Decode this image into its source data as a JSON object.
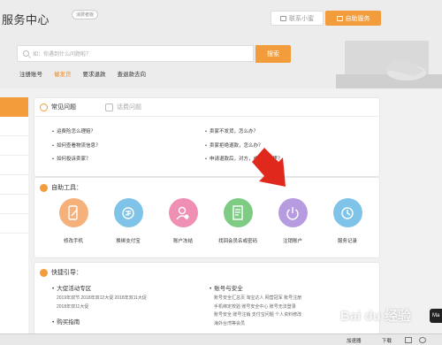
{
  "header": {
    "title": "服务中心",
    "beta_badge": "消费者版",
    "contact_label": "联系小蜜",
    "self_service_label": "自助服务"
  },
  "search": {
    "placeholder": "如：你遇到什么问题啦？",
    "button_label": "搜索"
  },
  "quick_links": [
    "注册账号",
    "催发货",
    "要求退款",
    "查退款去向"
  ],
  "faq": {
    "tab_active": "常见问题",
    "tab_inactive": "话费问题",
    "col1": [
      "运费险怎么理赔？",
      "如何查看物流信息？",
      "如何投诉卖家？"
    ],
    "col2": [
      "卖家不发货，怎么办？",
      "卖家拒绝退款，怎么办？",
      "申请退款后，对方，或退到哪里？"
    ]
  },
  "tools": {
    "title": "自助工具：",
    "items": [
      {
        "label": "修改手机",
        "color": "#f6b07a",
        "icon": "phone-edit-icon"
      },
      {
        "label": "换绑支付宝",
        "color": "#7fc3e8",
        "icon": "alipay-rebind-icon"
      },
      {
        "label": "账户冻结",
        "color": "#ef8fb3",
        "icon": "account-freeze-icon"
      },
      {
        "label": "找回会员名或密码",
        "color": "#7ecb84",
        "icon": "document-icon"
      },
      {
        "label": "注销账户",
        "color": "#b69be0",
        "icon": "power-icon"
      },
      {
        "label": "服务记录",
        "color": "#7fc3e8",
        "icon": "history-icon"
      }
    ]
  },
  "guide": {
    "title": "快捷引导：",
    "col1": {
      "head": "大促活动专区",
      "links": [
        "2019年双节  2018年双12大促  2018年双11大促",
        "2018年双11大促"
      ],
      "head2": "购买指南"
    },
    "col2": {
      "head": "账号与安全",
      "links": [
        "账号安全汇总页  淘宝达人  网营冠军  账号注册",
        "手机绑定校验  账号安全中心  账号无法登录",
        "账号安全  账号注销  支付宝问题  个人资料修改",
        "海外台湾等会员"
      ]
    }
  },
  "overlay": {
    "watermark": "Bai du 经验",
    "mac_badge": "Ma"
  },
  "statusbar": {
    "accelerator": "加速器",
    "download": "下载"
  },
  "colors": {
    "accent": "#f39c3c",
    "arrow": "#e0281c"
  }
}
